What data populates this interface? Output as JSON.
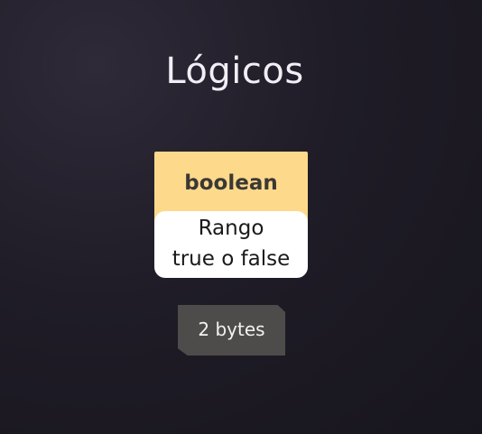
{
  "slide": {
    "title": "Lógicos",
    "card": {
      "type_name": "boolean",
      "range_line1": "Rango",
      "range_line2": "true o false"
    },
    "size": "2 bytes"
  },
  "colors": {
    "background": "#1f1c27",
    "card_header": "#fdd98b",
    "card_body": "#ffffff",
    "badge": "#4d4c4b"
  }
}
